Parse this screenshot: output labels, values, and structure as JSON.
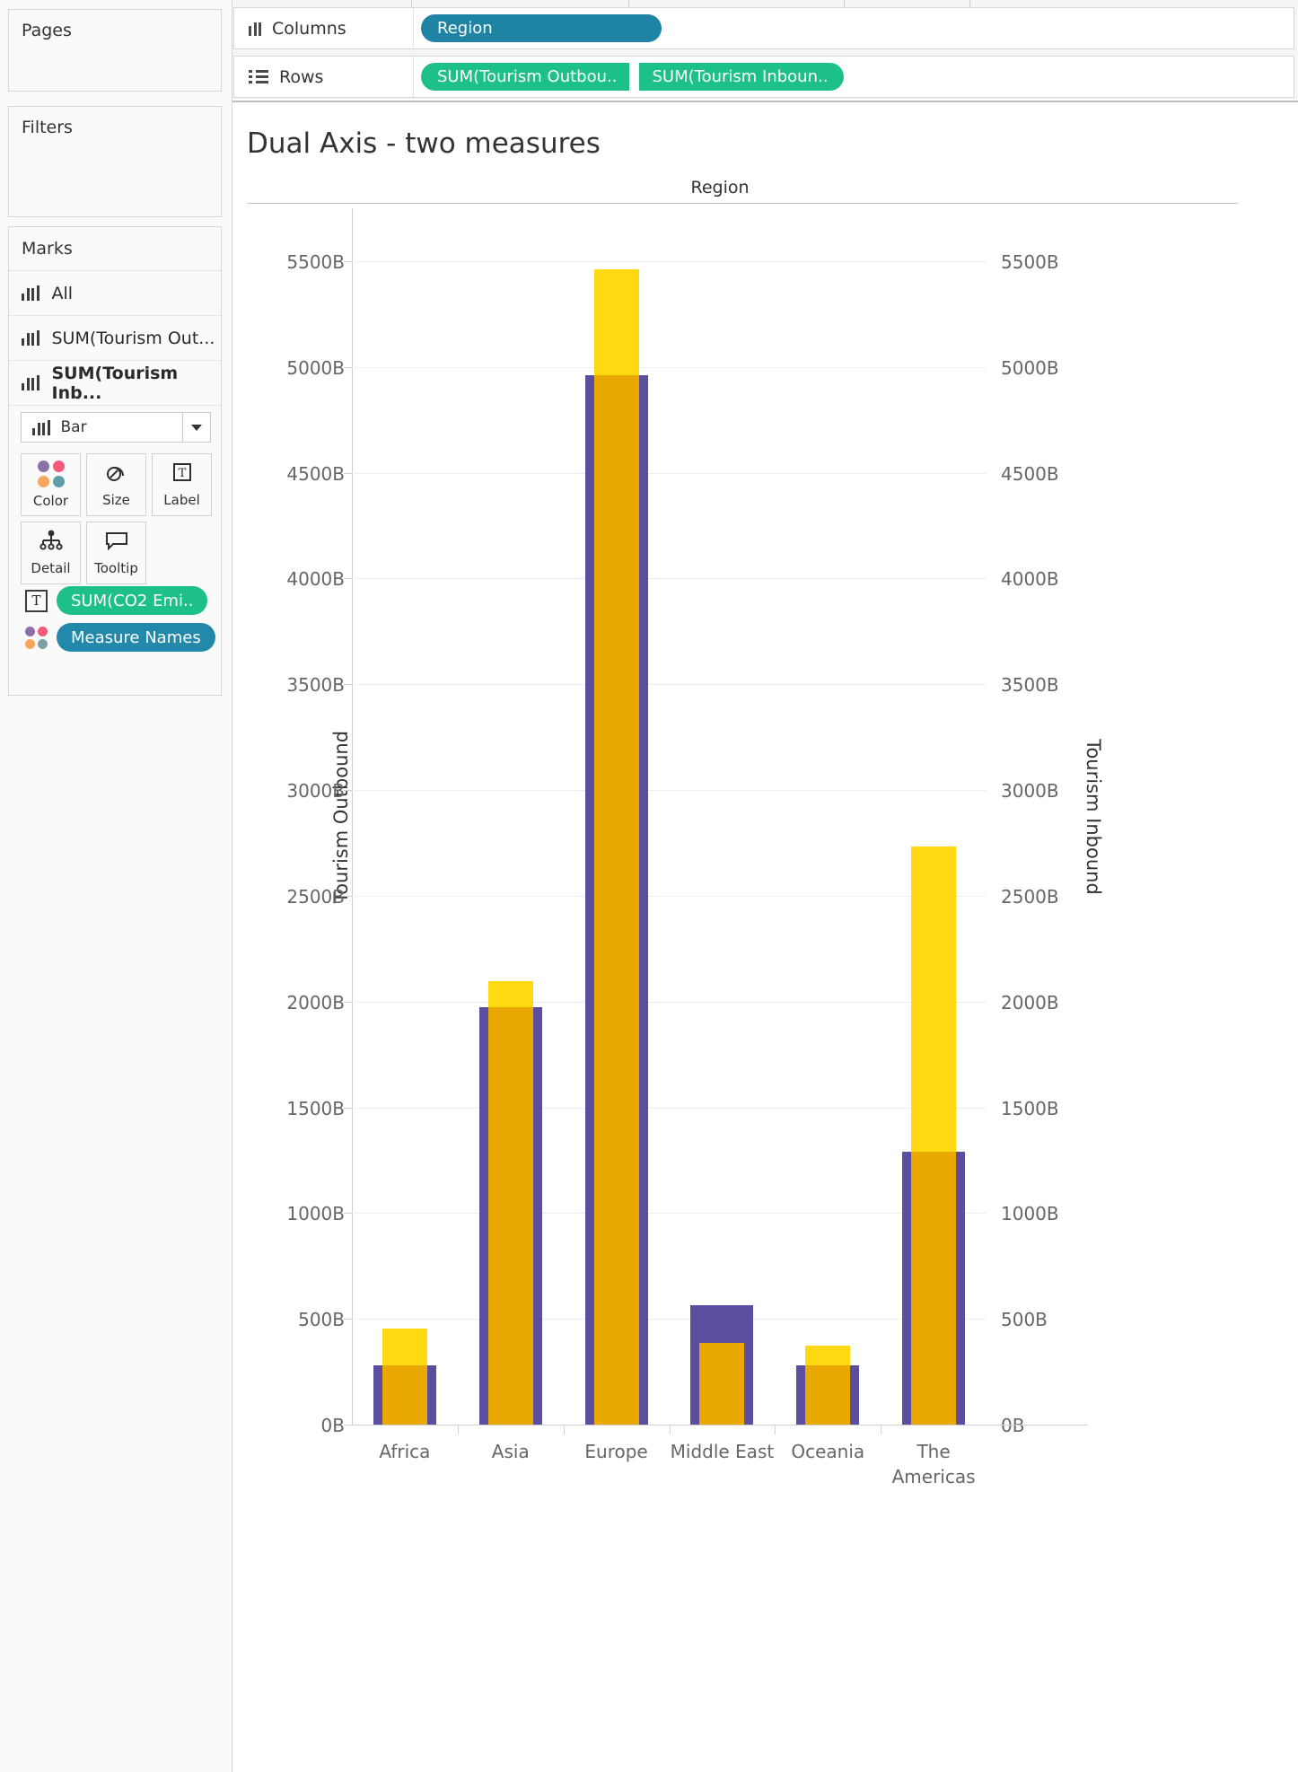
{
  "shelves": {
    "columns": {
      "label": "Columns",
      "icon": "columns-icon",
      "pills": [
        "Region"
      ]
    },
    "rows": {
      "label": "Rows",
      "icon": "rows-icon",
      "pills": [
        "SUM(Tourism Outbou..",
        "SUM(Tourism Inboun.."
      ]
    }
  },
  "cards": {
    "pages": "Pages",
    "filters": "Filters",
    "marks": {
      "title": "Marks",
      "levels": [
        {
          "label": "All",
          "active": false
        },
        {
          "label": "SUM(Tourism Out...",
          "active": false
        },
        {
          "label": "SUM(Tourism Inb...",
          "active": true
        }
      ],
      "mark_type": "Bar",
      "properties": [
        {
          "label": "Color",
          "icon": "color-dots-icon"
        },
        {
          "label": "Size",
          "icon": "size-icon"
        },
        {
          "label": "Label",
          "icon": "label-text-icon"
        },
        {
          "label": "Detail",
          "icon": "detail-hierarchy-icon"
        },
        {
          "label": "Tooltip",
          "icon": "tooltip-bubble-icon"
        }
      ],
      "encoding_pills": [
        {
          "label": "SUM(CO2 Emi..",
          "icon": "label-text-icon",
          "color": "#1ec08a"
        },
        {
          "label": "Measure Names",
          "icon": "color-dots-icon",
          "color": "#2389ab"
        }
      ]
    }
  },
  "colors": {
    "pill_blue": "#1f83a3",
    "pill_green": "#1ec08a",
    "outbound": "#5b4e9e",
    "inbound": "#e9a900",
    "inbound_light": "#ffd911"
  },
  "chart_data": {
    "type": "bar",
    "title": "Dual Axis - two measures",
    "column_header": "Region",
    "xlabel": "Region",
    "categories": [
      "Africa",
      "Asia",
      "Europe",
      "Middle East",
      "Oceania",
      "The Americas"
    ],
    "series": [
      {
        "name": "Tourism Outbound",
        "axis": "left",
        "color": "#5b4e9e",
        "values": [
          280,
          1975,
          4960,
          565,
          280,
          1290
        ]
      },
      {
        "name": "Tourism Inbound",
        "axis": "right",
        "color": "#e9a900",
        "values": [
          455,
          2095,
          5460,
          385,
          375,
          2735
        ]
      }
    ],
    "left_axis": {
      "label": "Tourism Outbound",
      "ticks": [
        "0B",
        "500B",
        "1000B",
        "1500B",
        "2000B",
        "2500B",
        "3000B",
        "3500B",
        "4000B",
        "4500B",
        "5000B",
        "5500B"
      ],
      "min": 0,
      "max": 5750
    },
    "right_axis": {
      "label": "Tourism Inbound",
      "ticks": [
        "0B",
        "500B",
        "1000B",
        "1500B",
        "2000B",
        "2500B",
        "3000B",
        "3500B",
        "4000B",
        "4500B",
        "5000B",
        "5500B"
      ],
      "min": 0,
      "max": 5750
    },
    "grid": true,
    "legend": "none"
  }
}
